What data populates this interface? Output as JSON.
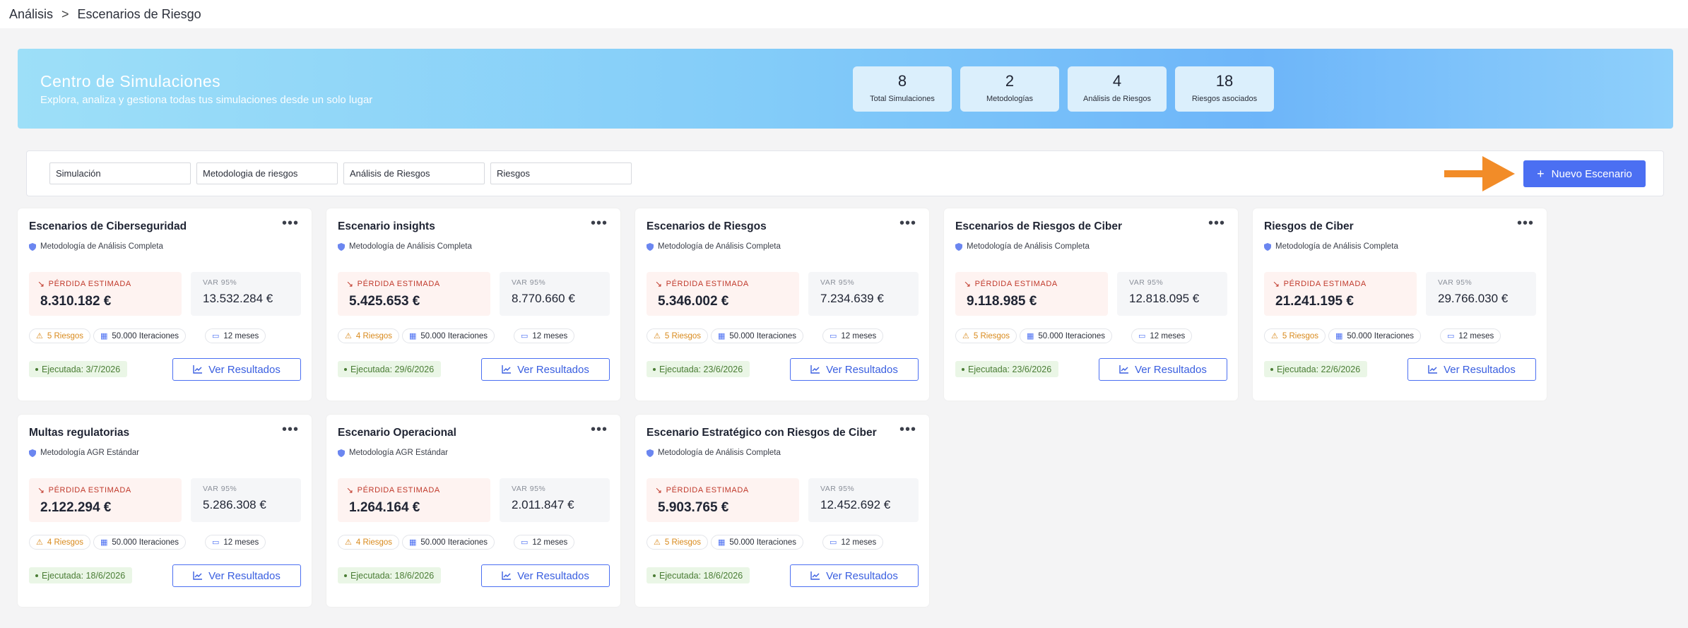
{
  "breadcrumb": {
    "parent": "Análisis",
    "separator": ">",
    "current": "Escenarios de Riesgo"
  },
  "hero": {
    "title": "Centro de Simulaciones",
    "subtitle": "Explora, analiza y gestiona todas tus simulaciones desde un solo lugar",
    "stats": [
      {
        "value": "8",
        "label": "Total Simulaciones"
      },
      {
        "value": "2",
        "label": "Metodologías"
      },
      {
        "value": "4",
        "label": "Análisis de Riesgos"
      },
      {
        "value": "18",
        "label": "Riesgos asociados"
      }
    ]
  },
  "filters": [
    {
      "placeholder": "Simulación"
    },
    {
      "placeholder": "Metodologia de riesgos"
    },
    {
      "placeholder": "Análisis de Riesgos"
    },
    {
      "placeholder": "Riesgos"
    }
  ],
  "new_button": {
    "label": "Nuevo Escenario",
    "icon": "plus-icon"
  },
  "colors": {
    "accent": "#4b6ff2",
    "arrow": "#f28c28",
    "loss_bg": "#fef3f1",
    "loss_text": "#c0392b",
    "exec_bg": "#eaf6e6",
    "exec_text": "#4a7d35",
    "risk_chip": "#d98a1c"
  },
  "card_labels": {
    "loss_label": "PÉRDIDA ESTIMADA",
    "var_label": "VAR 95%",
    "results_button": "Ver Resultados",
    "more_icon": "•••"
  },
  "cards": [
    {
      "title": "Escenarios de Ciberseguridad",
      "methodology": "Metodología de Análisis Completa",
      "loss": "8.310.182 €",
      "var": "13.532.284 €",
      "risks": "5 Riesgos",
      "iterations": "50.000 Iteraciones",
      "period": "12 meses",
      "executed": "Ejecutada: 3/7/2026"
    },
    {
      "title": "Escenario insights",
      "methodology": "Metodología de Análisis Completa",
      "loss": "5.425.653 €",
      "var": "8.770.660 €",
      "risks": "4 Riesgos",
      "iterations": "50.000 Iteraciones",
      "period": "12 meses",
      "executed": "Ejecutada: 29/6/2026"
    },
    {
      "title": "Escenarios de Riesgos",
      "methodology": "Metodología de Análisis Completa",
      "loss": "5.346.002 €",
      "var": "7.234.639 €",
      "risks": "5 Riesgos",
      "iterations": "50.000 Iteraciones",
      "period": "12 meses",
      "executed": "Ejecutada: 23/6/2026"
    },
    {
      "title": "Escenarios de Riesgos de Ciber",
      "methodology": "Metodología de Análisis Completa",
      "loss": "9.118.985 €",
      "var": "12.818.095 €",
      "risks": "5 Riesgos",
      "iterations": "50.000 Iteraciones",
      "period": "12 meses",
      "executed": "Ejecutada: 23/6/2026"
    },
    {
      "title": "Riesgos de Ciber",
      "methodology": "Metodología de Análisis Completa",
      "loss": "21.241.195 €",
      "var": "29.766.030 €",
      "risks": "5 Riesgos",
      "iterations": "50.000 Iteraciones",
      "period": "12 meses",
      "executed": "Ejecutada: 22/6/2026"
    },
    {
      "title": "Multas regulatorias",
      "methodology": "Metodología AGR Estándar",
      "loss": "2.122.294 €",
      "var": "5.286.308 €",
      "risks": "4 Riesgos",
      "iterations": "50.000 Iteraciones",
      "period": "12 meses",
      "executed": "Ejecutada: 18/6/2026"
    },
    {
      "title": "Escenario Operacional",
      "methodology": "Metodología AGR Estándar",
      "loss": "1.264.164 €",
      "var": "2.011.847 €",
      "risks": "4 Riesgos",
      "iterations": "50.000 Iteraciones",
      "period": "12 meses",
      "executed": "Ejecutada: 18/6/2026"
    },
    {
      "title": "Escenario Estratégico con Riesgos de Ciber",
      "methodology": "Metodología de Análisis Completa",
      "loss": "5.903.765 €",
      "var": "12.452.692 €",
      "risks": "5 Riesgos",
      "iterations": "50.000 Iteraciones",
      "period": "12 meses",
      "executed": "Ejecutada: 18/6/2026"
    }
  ]
}
